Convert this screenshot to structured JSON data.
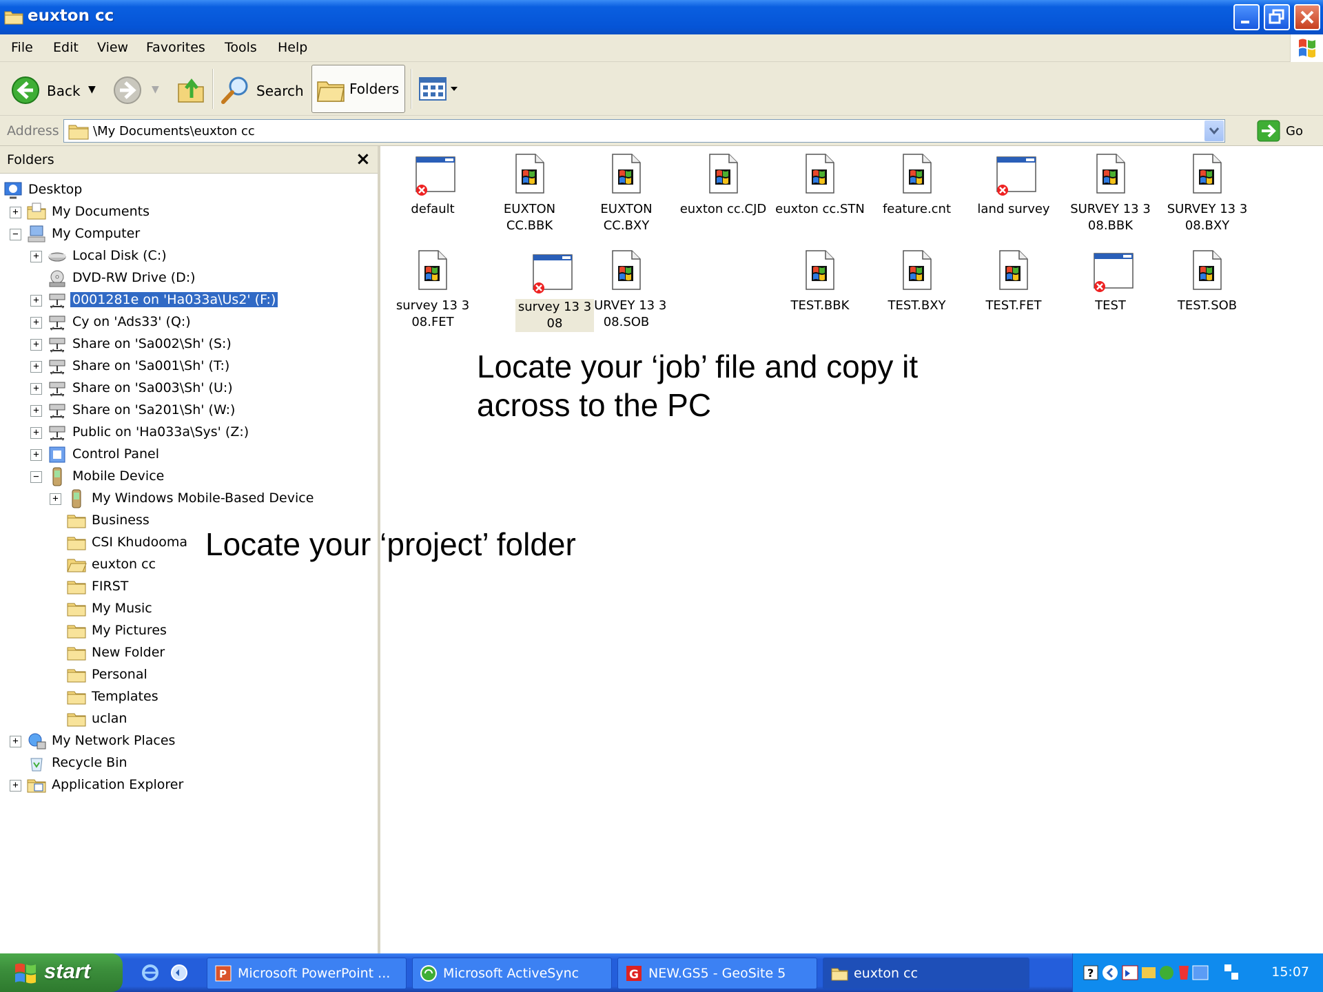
{
  "window": {
    "title": "euxton cc"
  },
  "menu": [
    "File",
    "Edit",
    "View",
    "Favorites",
    "Tools",
    "Help"
  ],
  "toolbar": {
    "back": "Back",
    "search": "Search",
    "folders": "Folders"
  },
  "address": {
    "label": "Address",
    "value": "\\My Documents\\euxton cc",
    "go": "Go"
  },
  "folders_pane": {
    "title": "Folders",
    "close": "×",
    "tree": [
      {
        "label": "Desktop",
        "level": 0,
        "icon": "desktop-icon",
        "expander": ""
      },
      {
        "label": "My Documents",
        "level": 1,
        "icon": "my-documents-icon",
        "expander": "+"
      },
      {
        "label": "My Computer",
        "level": 1,
        "icon": "my-computer-icon",
        "expander": "−"
      },
      {
        "label": "Local Disk (C:)",
        "level": 2,
        "icon": "hard-disk-icon",
        "expander": "+"
      },
      {
        "label": "DVD-RW Drive (D:)",
        "level": 2,
        "icon": "dvd-drive-icon",
        "expander": ""
      },
      {
        "label": "0001281e on 'Ha033a\\Us2' (F:)",
        "level": 2,
        "icon": "network-drive-icon",
        "expander": "+",
        "selected": true
      },
      {
        "label": "Cy on 'Ads33' (Q:)",
        "level": 2,
        "icon": "network-drive-icon",
        "expander": "+"
      },
      {
        "label": "Share on 'Sa002\\Sh' (S:)",
        "level": 2,
        "icon": "network-drive-icon",
        "expander": "+"
      },
      {
        "label": "Share on 'Sa001\\Sh' (T:)",
        "level": 2,
        "icon": "network-drive-icon",
        "expander": "+"
      },
      {
        "label": "Share on 'Sa003\\Sh' (U:)",
        "level": 2,
        "icon": "network-drive-icon",
        "expander": "+"
      },
      {
        "label": "Share on 'Sa201\\Sh' (W:)",
        "level": 2,
        "icon": "network-drive-icon",
        "expander": "+"
      },
      {
        "label": "Public on 'Ha033a\\Sys' (Z:)",
        "level": 2,
        "icon": "network-drive-icon",
        "expander": "+"
      },
      {
        "label": "Control Panel",
        "level": 2,
        "icon": "control-panel-icon",
        "expander": "+"
      },
      {
        "label": "Mobile Device",
        "level": 2,
        "icon": "mobile-device-icon",
        "expander": "−"
      },
      {
        "label": "My Windows Mobile-Based Device",
        "level": 3,
        "icon": "mobile-device-icon",
        "expander": "+"
      },
      {
        "label": "Business",
        "level": 3,
        "icon": "folder-icon",
        "expander": ""
      },
      {
        "label": "CSI Khudooma",
        "level": 3,
        "icon": "folder-icon",
        "expander": ""
      },
      {
        "label": "euxton cc",
        "level": 3,
        "icon": "open-folder-icon",
        "expander": ""
      },
      {
        "label": "FIRST",
        "level": 3,
        "icon": "folder-icon",
        "expander": ""
      },
      {
        "label": "My Music",
        "level": 3,
        "icon": "folder-icon",
        "expander": ""
      },
      {
        "label": "My Pictures",
        "level": 3,
        "icon": "folder-icon",
        "expander": ""
      },
      {
        "label": "New Folder",
        "level": 3,
        "icon": "folder-icon",
        "expander": ""
      },
      {
        "label": "Personal",
        "level": 3,
        "icon": "folder-icon",
        "expander": ""
      },
      {
        "label": "Templates",
        "level": 3,
        "icon": "folder-icon",
        "expander": ""
      },
      {
        "label": "uclan",
        "level": 3,
        "icon": "folder-icon",
        "expander": ""
      },
      {
        "label": "My Network Places",
        "level": 1,
        "icon": "network-places-icon",
        "expander": "+"
      },
      {
        "label": "Recycle Bin",
        "level": 1,
        "icon": "recycle-bin-icon",
        "expander": ""
      },
      {
        "label": "Application Explorer",
        "level": 1,
        "icon": "application-explorer-icon",
        "expander": "+"
      }
    ]
  },
  "files": [
    {
      "name": "default",
      "type": "window"
    },
    {
      "name": "EUXTON CC.BBK",
      "type": "doc"
    },
    {
      "name": "EUXTON CC.BXY",
      "type": "doc"
    },
    {
      "name": "euxton cc.CJD",
      "type": "doc"
    },
    {
      "name": "euxton cc.STN",
      "type": "doc"
    },
    {
      "name": "feature.cnt",
      "type": "doc"
    },
    {
      "name": "land survey",
      "type": "window"
    },
    {
      "name": "SURVEY 13 3 08.BBK",
      "type": "doc"
    },
    {
      "name": "SURVEY 13 3 08.BXY",
      "type": "doc"
    },
    {
      "name": "survey 13 3 08.FET",
      "type": "doc"
    },
    {
      "name": "survey 13 3 08",
      "type": "window",
      "selected": true
    },
    {
      "name": "SURVEY 13 3 08.SOB",
      "type": "doc"
    },
    {
      "name": "TEST.BBK",
      "type": "doc"
    },
    {
      "name": "TEST.BXY",
      "type": "doc"
    },
    {
      "name": "TEST.FET",
      "type": "doc"
    },
    {
      "name": "TEST",
      "type": "window"
    },
    {
      "name": "TEST.SOB",
      "type": "doc"
    }
  ],
  "annotations": {
    "job": "Locate your ‘job’ file and copy it across to the PC",
    "project": "Locate your ‘project’ folder"
  },
  "taskbar": {
    "start": "start",
    "tasks": [
      {
        "label": "Microsoft PowerPoint ...",
        "icon": "powerpoint-icon"
      },
      {
        "label": "Microsoft ActiveSync",
        "icon": "activesync-icon"
      },
      {
        "label": "NEW.GS5 - GeoSite 5",
        "icon": "geosite-icon"
      },
      {
        "label": "euxton cc",
        "icon": "explorer-folder-icon",
        "active": true
      }
    ],
    "clock": "15:07"
  },
  "colors": {
    "titlebar": "#0554d6",
    "selection": "#316ac5",
    "taskbar": "#245edb",
    "start": "#3c8f3c",
    "chrome": "#ece9d8"
  }
}
